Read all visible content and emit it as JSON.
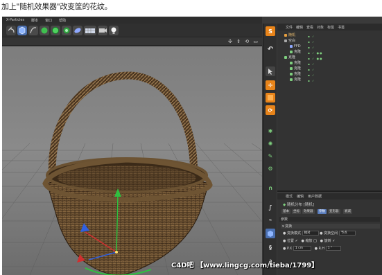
{
  "caption": "加上\"随机效果器\"改变筐的花纹。",
  "app": {
    "menubar": [
      "X-Particles",
      "脚本",
      "窗口",
      "帮助"
    ],
    "viewport_nav": "✣ ⇕ ⟲ ▭"
  },
  "object_manager": {
    "tabs": [
      "文件",
      "编辑",
      "查看",
      "对象",
      "标签",
      "书签"
    ],
    "rows": [
      {
        "label": "随机",
        "indent": 0,
        "color": "#e8a040"
      },
      {
        "label": "空白",
        "indent": 0,
        "color": "#aaaaaa"
      },
      {
        "label": "FFD",
        "indent": 1,
        "color": "#8fa8ff"
      },
      {
        "label": "克隆",
        "indent": 1,
        "color": "#7fd07f"
      },
      {
        "label": "克隆",
        "indent": 0,
        "color": "#7fd07f"
      },
      {
        "label": "克隆",
        "indent": 1,
        "color": "#7fd07f"
      },
      {
        "label": "克隆",
        "indent": 1,
        "color": "#7fd07f"
      },
      {
        "label": "克隆",
        "indent": 1,
        "color": "#7fd07f"
      },
      {
        "label": "克隆",
        "indent": 1,
        "color": "#7fd07f"
      }
    ]
  },
  "attributes": {
    "tabs": [
      "模式",
      "编辑",
      "用户数据"
    ],
    "title": "随机分布 [随机]",
    "subtabs": [
      "基本",
      "坐标",
      "效果器",
      "参数",
      "变形器",
      "衰减"
    ],
    "active_subtab": "参数",
    "section": "参数",
    "subsection": "▾ 变换",
    "transform_mode_label": "变换模式",
    "transform_mode_value": "相对",
    "transform_space_label": "变换空间",
    "transform_space_value": "节点",
    "position_label": "位置",
    "scale_label": "缩放",
    "rotation_label": "旋转",
    "px_label": "P.X",
    "px_value": "1 cm",
    "rh_label": "R.H",
    "rh_value": "1 °"
  },
  "watermark": "C4D吧 【www.lingcg.com/tieba/1799】",
  "colors": {
    "accent_orange": "#e8841a",
    "axis_red": "#d03030",
    "axis_green": "#30c040",
    "axis_blue": "#3060e0",
    "basket_brown": "#5a4228"
  }
}
